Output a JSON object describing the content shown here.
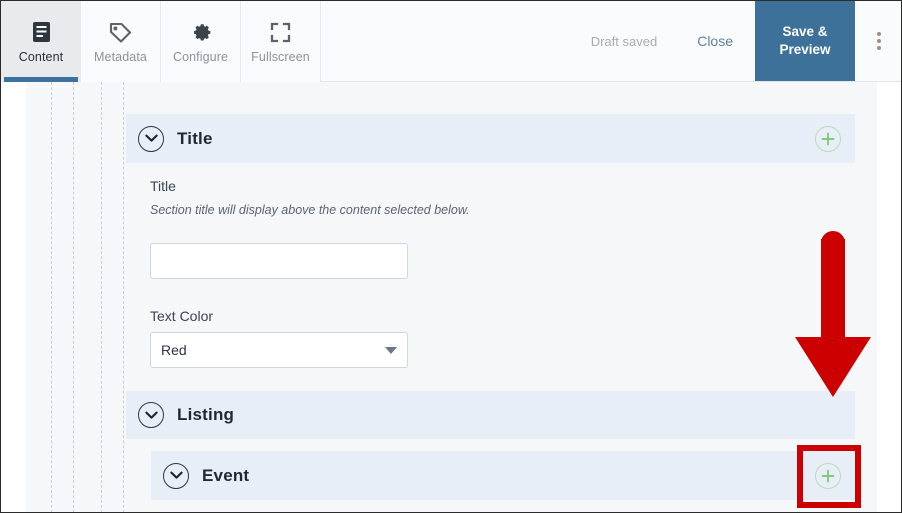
{
  "toolbar": {
    "tabs": [
      {
        "label": "Content",
        "icon": "document-lines-icon",
        "active": true
      },
      {
        "label": "Metadata",
        "icon": "tag-icon",
        "active": false
      },
      {
        "label": "Configure",
        "icon": "gear-icon",
        "active": false
      },
      {
        "label": "Fullscreen",
        "icon": "expand-icon",
        "active": false
      }
    ],
    "draft_status": "Draft saved",
    "close_label": "Close",
    "save_preview_line1": "Save &",
    "save_preview_line2": "Preview",
    "overflow_icon": "kebab-menu-icon"
  },
  "sections": {
    "title": {
      "header": "Title",
      "collapse_icon": "chevron-down-icon",
      "add_icon": "plus-circle-icon",
      "fields": {
        "title": {
          "label": "Title",
          "hint": "Section title will display above the content selected below.",
          "value": "",
          "placeholder": ""
        },
        "text_color": {
          "label": "Text Color",
          "value": "Red",
          "options": [
            "Red"
          ],
          "caret_icon": "chevron-down-icon"
        }
      }
    },
    "listing": {
      "header": "Listing",
      "collapse_icon": "chevron-down-icon"
    },
    "event": {
      "header": "Event",
      "collapse_icon": "chevron-down-icon",
      "add_icon": "plus-circle-icon"
    }
  },
  "annotations": {
    "arrow": {
      "name": "red-down-arrow",
      "color": "#cc0000"
    },
    "highlight_box": {
      "name": "red-highlight-box",
      "color": "#cc0000"
    }
  },
  "colors": {
    "accent_blue": "#3d719a",
    "panel_blue": "#e8eef8",
    "canvas_gray": "#f5f7f9",
    "add_green": "#7fc97f",
    "annotation_red": "#cc0000"
  }
}
